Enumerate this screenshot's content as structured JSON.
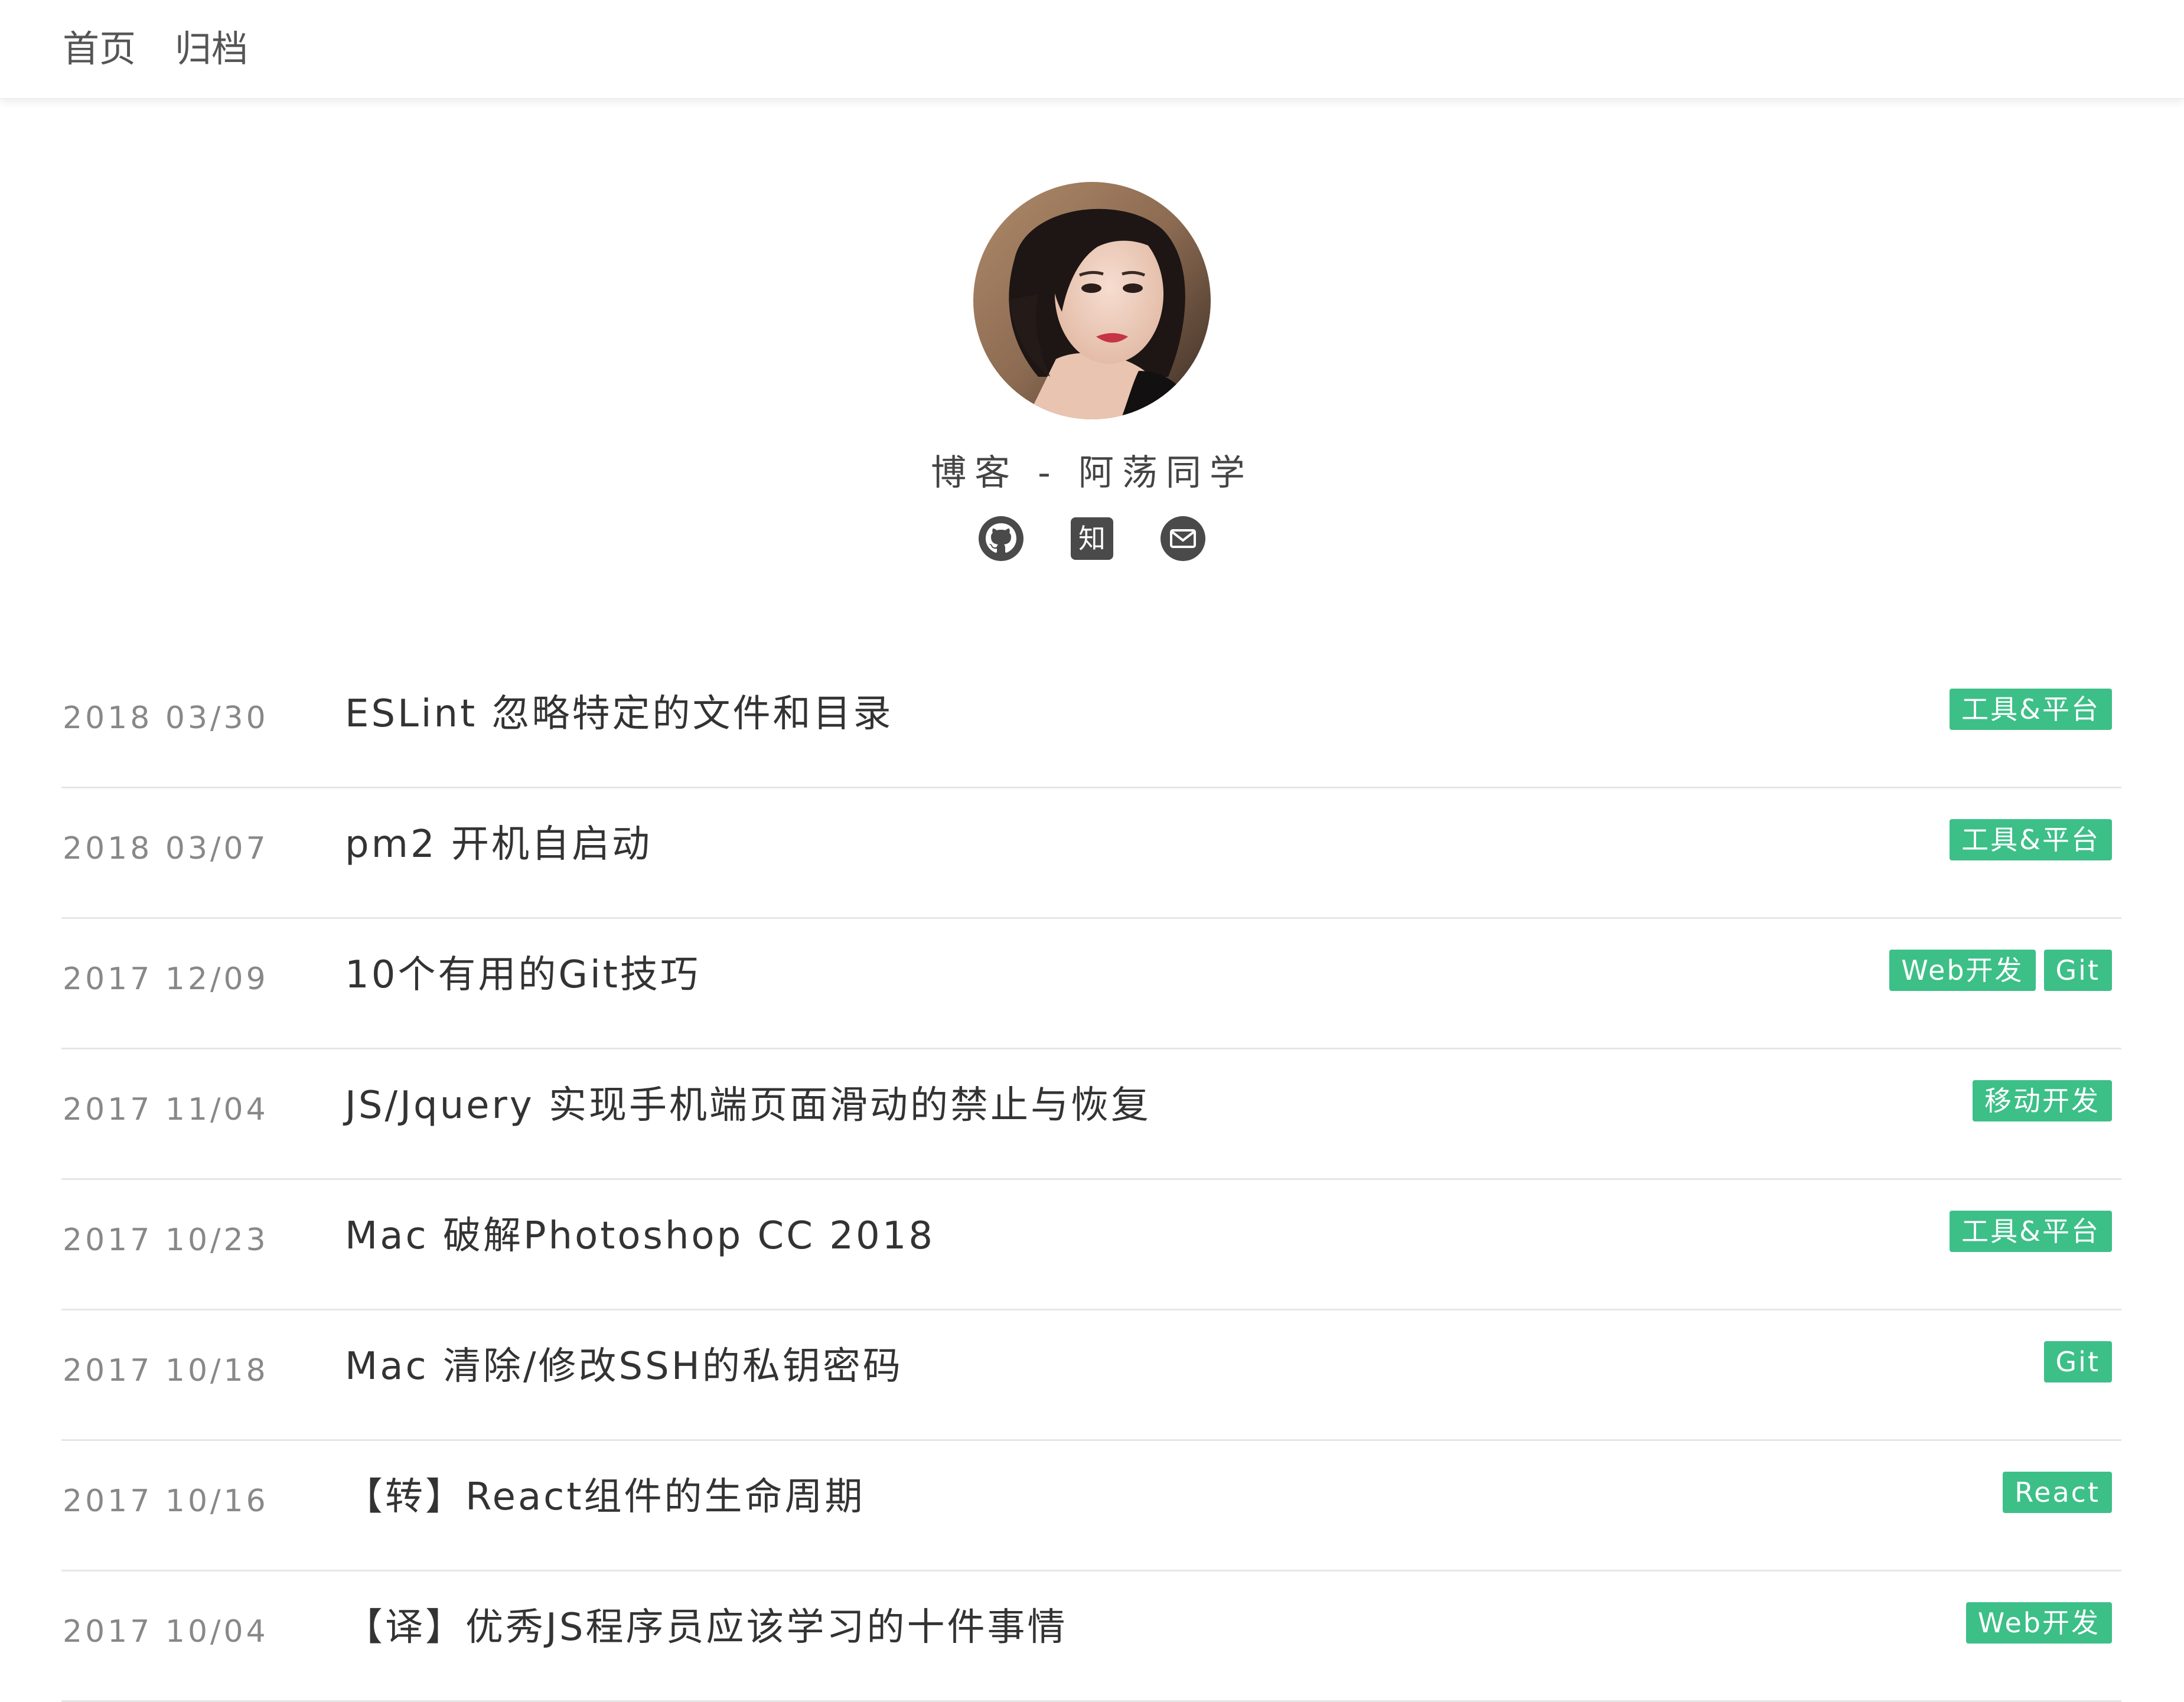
{
  "nav": {
    "home": "首页",
    "archive": "归档"
  },
  "profile": {
    "title": "博客 - 阿荡同学",
    "social_icons": [
      "github-icon",
      "zhihu-icon",
      "mail-icon"
    ],
    "zhihu_glyph": "知"
  },
  "colors": {
    "tag_bg": "#3dbf88",
    "text": "#333333",
    "date": "#888888",
    "icon": "#4a4a4a"
  },
  "posts": [
    {
      "date": "2018 03/30",
      "title": "ESLint 忽略特定的文件和目录",
      "tags": [
        "工具&平台"
      ]
    },
    {
      "date": "2018 03/07",
      "title": "pm2 开机自启动",
      "tags": [
        "工具&平台"
      ]
    },
    {
      "date": "2017 12/09",
      "title": "10个有用的Git技巧",
      "tags": [
        "Web开发",
        "Git"
      ]
    },
    {
      "date": "2017 11/04",
      "title": "JS/Jquery 实现手机端页面滑动的禁止与恢复",
      "tags": [
        "移动开发"
      ]
    },
    {
      "date": "2017 10/23",
      "title": "Mac 破解Photoshop CC 2018",
      "tags": [
        "工具&平台"
      ]
    },
    {
      "date": "2017 10/18",
      "title": "Mac 清除/修改SSH的私钥密码",
      "tags": [
        "Git"
      ]
    },
    {
      "date": "2017 10/16",
      "title": "【转】React组件的生命周期",
      "tags": [
        "React"
      ]
    },
    {
      "date": "2017 10/04",
      "title": "【译】优秀JS程序员应该学习的十件事情",
      "tags": [
        "Web开发"
      ]
    }
  ]
}
